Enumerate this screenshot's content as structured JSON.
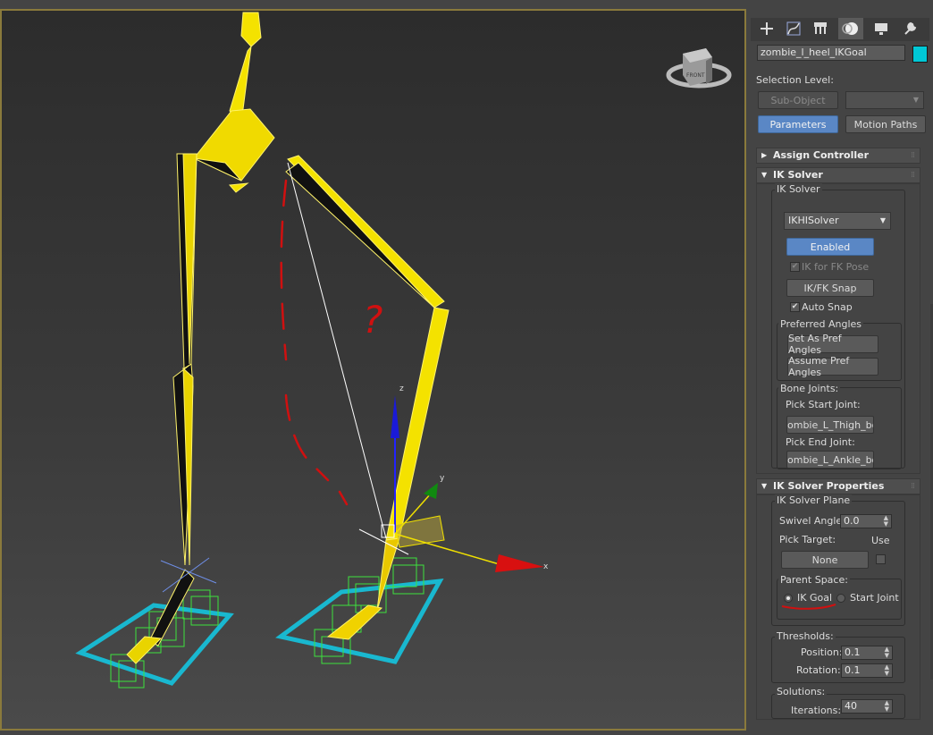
{
  "viewport": {
    "viewcube_label": "FRONT",
    "axis_labels": {
      "x": "x",
      "y": "y",
      "z": "z"
    },
    "annotation": "?"
  },
  "panel": {
    "tabs": [
      {
        "name": "create-tab",
        "icon": "plus-icon"
      },
      {
        "name": "modify-tab",
        "icon": "modify-curve-icon"
      },
      {
        "name": "hierarchy-tab",
        "icon": "hierarchy-icon"
      },
      {
        "name": "motion-tab",
        "icon": "motion-icon",
        "active": true
      },
      {
        "name": "display-tab",
        "icon": "monitor-icon"
      },
      {
        "name": "utilities-tab",
        "icon": "wrench-icon"
      }
    ],
    "object_name": "zombie_l_heel_IKGoal",
    "object_color": "#00c8d6",
    "selection_level_label": "Selection Level:",
    "sub_object_label": "Sub-Object",
    "parameters_label": "Parameters",
    "motion_paths_label": "Motion Paths",
    "assign_controller_title": "Assign Controller",
    "ik_solver": {
      "title": "IK Solver",
      "group_title": "IK Solver",
      "solver_type": "IKHISolver",
      "enabled_label": "Enabled",
      "ik_for_fk_label": "IK for FK Pose",
      "ik_fk_snap_label": "IK/FK Snap",
      "auto_snap_label": "Auto Snap",
      "preferred_angles_title": "Preferred Angles",
      "set_pref_label": "Set As Pref Angles",
      "assume_pref_label": "Assume Pref Angles",
      "bone_joints_title": "Bone Joints:",
      "pick_start_label": "Pick Start Joint:",
      "start_joint": "ombie_L_Thigh_bon",
      "pick_end_label": "Pick End Joint:",
      "end_joint": "ombie_L_Ankle_bon"
    },
    "ik_props": {
      "title": "IK Solver Properties",
      "plane_title": "IK Solver Plane",
      "swivel_label": "Swivel Angle:",
      "swivel_value": "0.0",
      "pick_target_label": "Pick Target:",
      "use_label": "Use",
      "target_value": "None",
      "parent_space_title": "Parent Space:",
      "ik_goal_label": "IK Goal",
      "start_joint_label": "Start Joint",
      "thresholds_title": "Thresholds:",
      "position_label": "Position:",
      "position_value": "0.1",
      "rotation_label": "Rotation:",
      "rotation_value": "0.1",
      "solutions_title": "Solutions:",
      "iterations_label": "Iterations:",
      "iterations_value": "40"
    }
  }
}
